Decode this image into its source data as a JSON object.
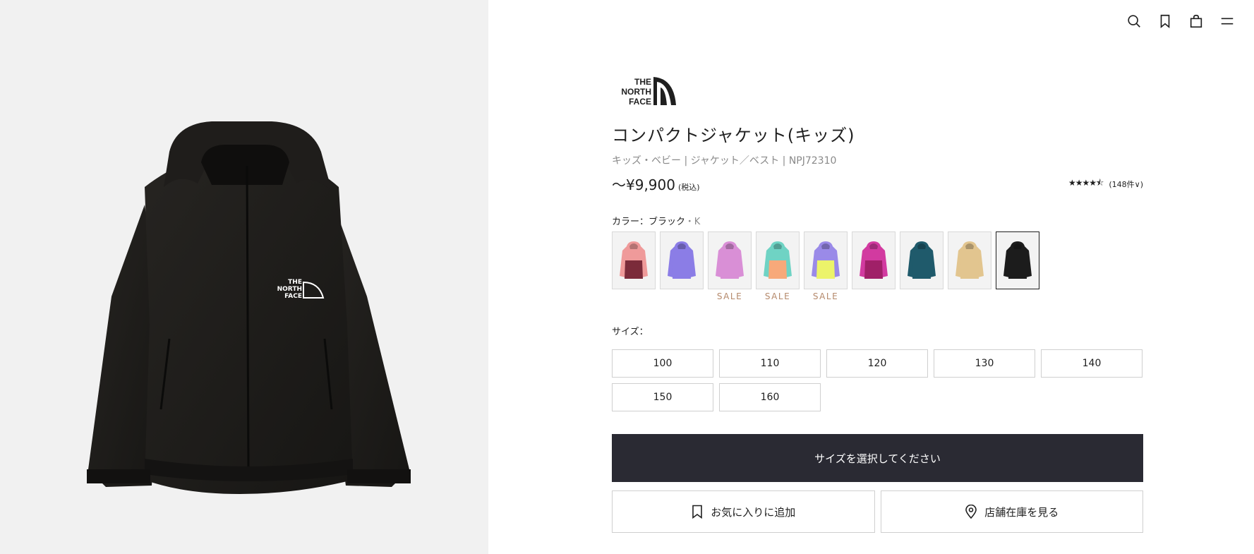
{
  "brand": {
    "logo_text": [
      "THE",
      "NORTH",
      "FACE"
    ]
  },
  "product": {
    "title": "コンパクトジャケット(キッズ)",
    "category": "キッズ・ベビー | ジャケット／ベスト | NPJ72310",
    "price": "〜¥9,900",
    "tax_note": "(税込)",
    "rating_stars": "★★★★⯪",
    "review_count": "(148件∨)",
    "rating_value": 4.5
  },
  "color": {
    "label": "カラー：ブラック",
    "code": "・K",
    "swatches": [
      {
        "name": "pink-maroon",
        "body": "#ef9a9a",
        "bottom": "#7b2b3a",
        "sale": ""
      },
      {
        "name": "periwinkle",
        "body": "#8b7de6",
        "bottom": "#8b7de6",
        "sale": ""
      },
      {
        "name": "lilac-pink",
        "body": "#d98fd6",
        "bottom": "#d98fd6",
        "sale": "SALE"
      },
      {
        "name": "teal-peach",
        "body": "#6fd3c4",
        "bottom": "#f7a97a",
        "sale": "SALE"
      },
      {
        "name": "purple-yellow",
        "body": "#9a8ae8",
        "bottom": "#ecf36a",
        "sale": "SALE"
      },
      {
        "name": "magenta",
        "body": "#d23aa0",
        "bottom": "#a02068",
        "sale": ""
      },
      {
        "name": "dark-teal",
        "body": "#1f5a6b",
        "bottom": "#1f5a6b",
        "sale": ""
      },
      {
        "name": "beige",
        "body": "#e2c58f",
        "bottom": "#e2c58f",
        "sale": ""
      },
      {
        "name": "black",
        "body": "#1c1c1c",
        "bottom": "#1c1c1c",
        "sale": "",
        "selected": true
      }
    ]
  },
  "size": {
    "label": "サイズ：",
    "options": [
      "100",
      "110",
      "120",
      "130",
      "140",
      "150",
      "160"
    ]
  },
  "actions": {
    "primary": "サイズを選択してください",
    "favorite": "お気に入りに追加",
    "store_stock": "店舗在庫を見る"
  },
  "colors": {
    "cta_bg": "#2a2a33",
    "sale": "#b5896b",
    "jacket": "#1e1c1a"
  }
}
